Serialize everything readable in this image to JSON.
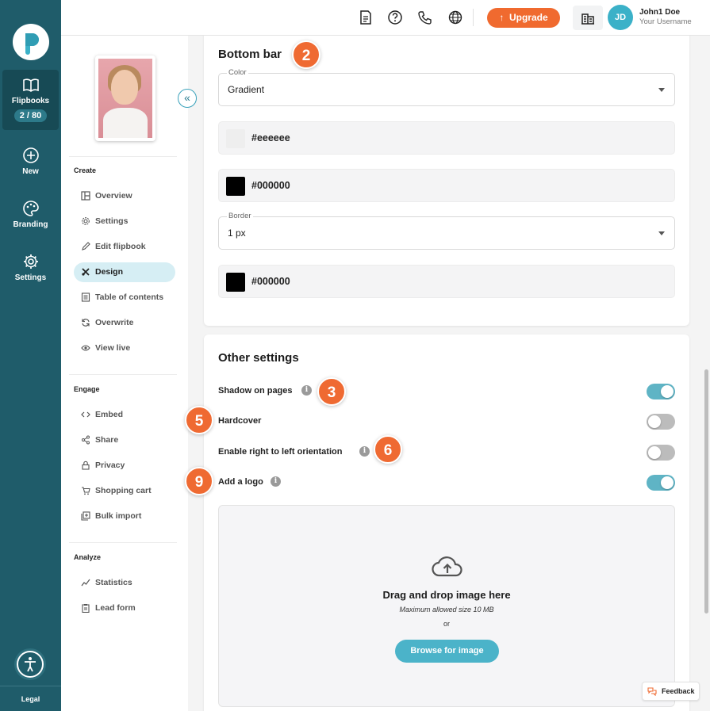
{
  "rail": {
    "items": [
      {
        "label": "Flipbooks",
        "count": "2 / 80",
        "icon": "book-icon"
      },
      {
        "label": "New",
        "icon": "plus-circle-icon"
      },
      {
        "label": "Branding",
        "icon": "palette-icon"
      },
      {
        "label": "Settings",
        "icon": "gear-icon"
      }
    ],
    "legal": "Legal"
  },
  "topbar": {
    "upgrade_label": "Upgrade",
    "avatar_initials": "JD",
    "user_name": "John1 Doe",
    "user_sub": "Your Username"
  },
  "sidenav": {
    "sections": [
      {
        "heading": "Create",
        "items": [
          "Overview",
          "Settings",
          "Edit flipbook",
          "Design",
          "Table of contents",
          "Overwrite",
          "View live"
        ]
      },
      {
        "heading": "Engage",
        "items": [
          "Embed",
          "Share",
          "Privacy",
          "Shopping cart",
          "Bulk import"
        ]
      },
      {
        "heading": "Analyze",
        "items": [
          "Statistics",
          "Lead form"
        ]
      }
    ],
    "active_item": "Design"
  },
  "bottom_bar": {
    "title": "Bottom bar",
    "color_label": "Color",
    "color_value": "Gradient",
    "swatch1": "#eeeeee",
    "swatch2": "#000000",
    "border_label": "Border",
    "border_value": "1 px",
    "swatch3": "#000000"
  },
  "other_settings": {
    "title": "Other settings",
    "rows": [
      {
        "label": "Shadow on pages",
        "info": true,
        "on": true
      },
      {
        "label": "Hardcover",
        "info": false,
        "on": false
      },
      {
        "label": "Enable right to left orientation",
        "info": true,
        "on": false
      },
      {
        "label": "Add a logo",
        "info": true,
        "on": true
      }
    ],
    "dropzone": {
      "title": "Drag and drop image here",
      "subtitle": "Maximum allowed size 10 MB",
      "or": "or",
      "button": "Browse for image"
    }
  },
  "badges": [
    "2",
    "3",
    "5",
    "6",
    "9"
  ],
  "feedback_label": "Feedback",
  "colors": {
    "rail": "#1f5c6a",
    "accent": "#ef6a32",
    "toggle_on": "#5fb4c5",
    "teal_button": "#4bb3c9"
  }
}
